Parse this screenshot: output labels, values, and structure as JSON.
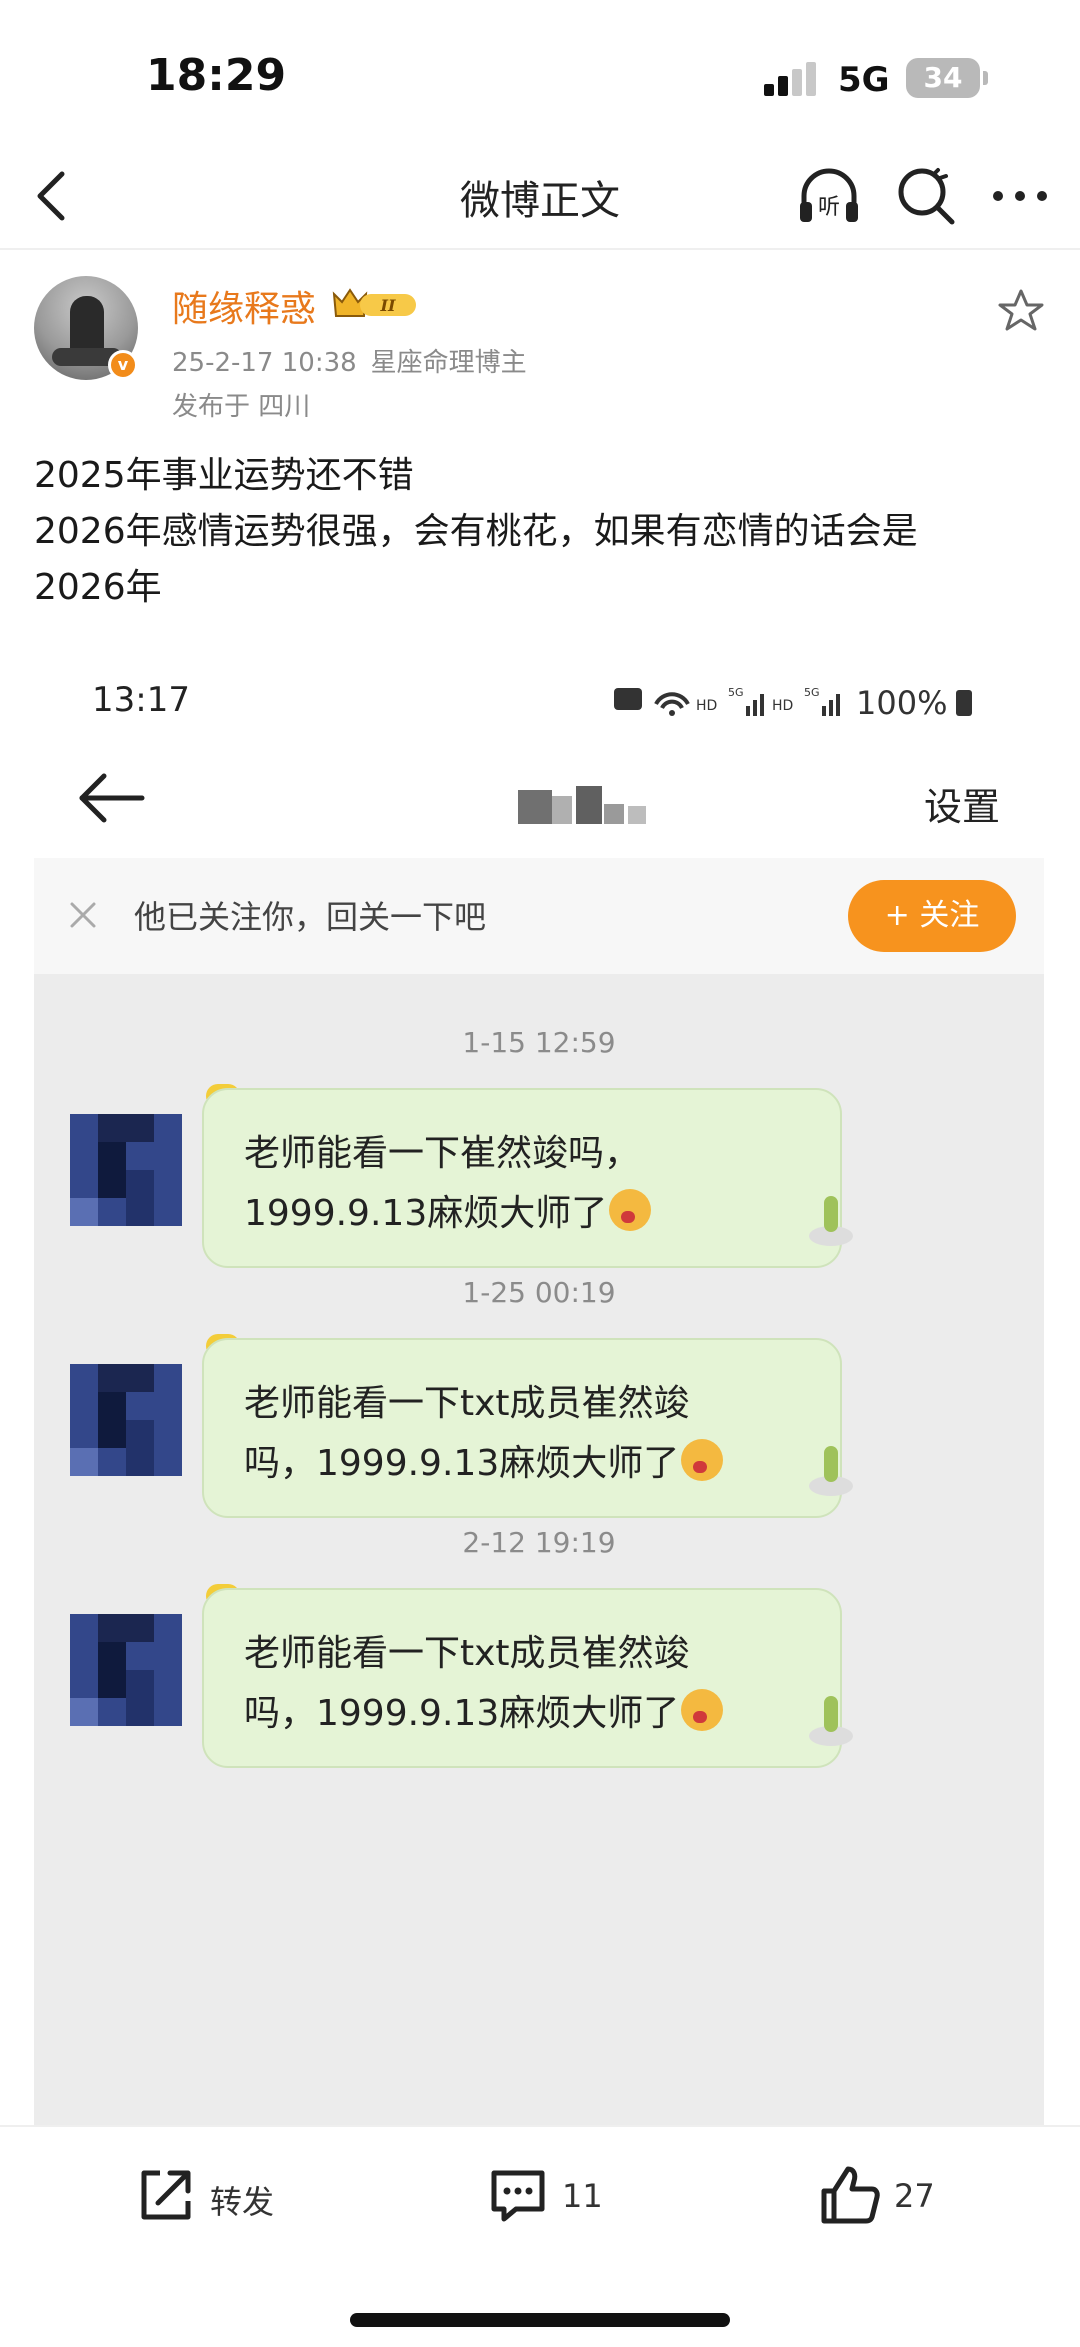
{
  "status_bar": {
    "time": "18:29",
    "network": "5G",
    "battery": "34"
  },
  "nav": {
    "title": "微博正文",
    "listen_icon": "listen-headphones-icon",
    "search_icon": "search-icon",
    "more_icon": "more-dots-icon"
  },
  "author": {
    "name": "随缘释惑",
    "badge_text": "II",
    "verified_mark": "v",
    "date": "25-2-17 10:38",
    "tag": "星座命理博主",
    "location": "发布于 四川"
  },
  "post": {
    "lines": [
      "2025年事业运势还不错",
      "2026年感情运势很强，会有桃花，如果有恋情的话会是",
      "2026年"
    ]
  },
  "embedded": {
    "time": "13:17",
    "status_right": "HD 5G HD 5G 100%",
    "settings": "设置",
    "follow_prompt": "他已关注你，回关一下吧",
    "follow_button": "+ 关注",
    "messages": [
      {
        "timestamp": "1-15 12:59",
        "line1": "老师能看一下崔然竣吗，",
        "line2": "1999.9.13麻烦大师了"
      },
      {
        "timestamp": "1-25 00:19",
        "line1": "老师能看一下txt成员崔然竣",
        "line2": "吗，1999.9.13麻烦大师了"
      },
      {
        "timestamp": "2-12 19:19",
        "line1": "老师能看一下txt成员崔然竣",
        "line2": "吗，1999.9.13麻烦大师了"
      }
    ]
  },
  "actions": {
    "repost_label": "转发",
    "comment_count": "11",
    "like_count": "27"
  },
  "colors": {
    "accent": "#e8791c",
    "follow_button": "#f7931e",
    "bubble": "#e5f4d6"
  }
}
